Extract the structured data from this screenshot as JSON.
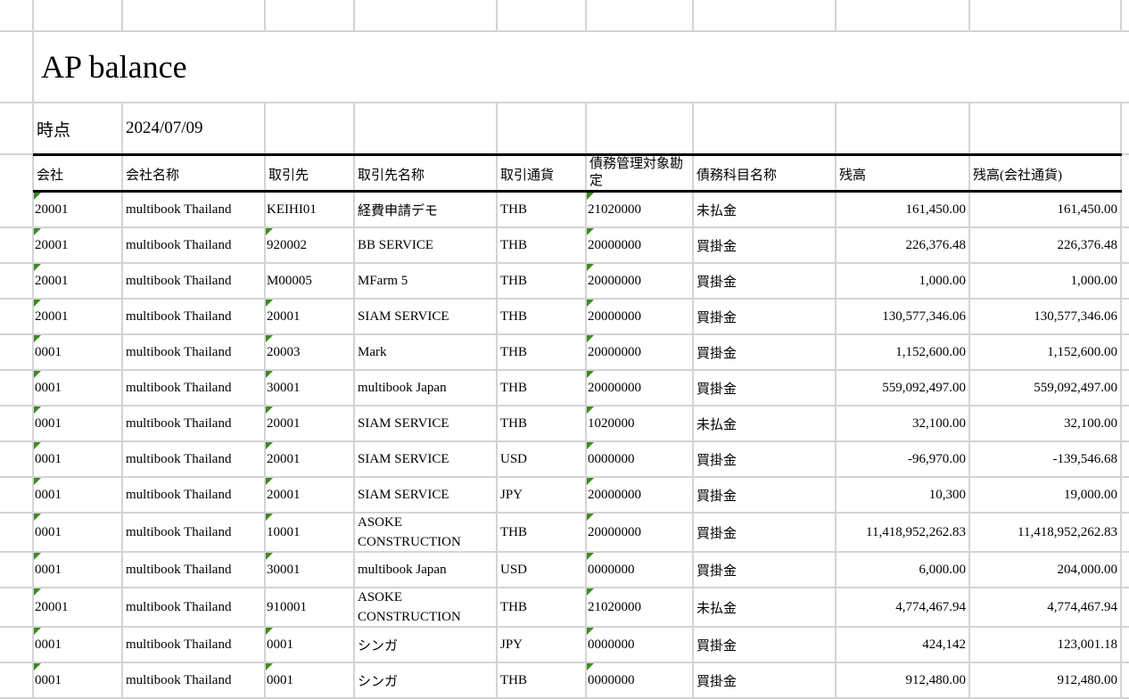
{
  "title": "AP balance",
  "as_of": {
    "label": "時点",
    "value": "2024/07/09"
  },
  "columns": [
    "会社",
    "会社名称",
    "取引先",
    "取引先名称",
    "取引通貨",
    "債務管理対象勘定",
    "債務科目名称",
    "残高",
    "残高(会社通貨)"
  ],
  "rows": [
    {
      "company": "20001",
      "company_name": "multibook Thailand",
      "partner": "KEIHI01",
      "partner_name": "経費申請デモ",
      "currency": "THB",
      "account": "21020000",
      "account_name": "未払金",
      "balance": "161,450.00",
      "balance_local": "161,450.00",
      "flag_company": true,
      "flag_partner": false,
      "flag_account": true
    },
    {
      "company": "20001",
      "company_name": "multibook Thailand",
      "partner": "920002",
      "partner_name": "BB SERVICE",
      "currency": "THB",
      "account": "20000000",
      "account_name": "買掛金",
      "balance": "226,376.48",
      "balance_local": "226,376.48",
      "flag_company": true,
      "flag_partner": true,
      "flag_account": true
    },
    {
      "company": "20001",
      "company_name": "multibook Thailand",
      "partner": "M00005",
      "partner_name": "MFarm 5",
      "currency": "THB",
      "account": "20000000",
      "account_name": "買掛金",
      "balance": "1,000.00",
      "balance_local": "1,000.00",
      "flag_company": true,
      "flag_partner": false,
      "flag_account": true
    },
    {
      "company": "20001",
      "company_name": "multibook Thailand",
      "partner": "20001",
      "partner_name": "SIAM SERVICE",
      "currency": "THB",
      "account": "20000000",
      "account_name": "買掛金",
      "balance": "130,577,346.06",
      "balance_local": "130,577,346.06",
      "flag_company": true,
      "flag_partner": true,
      "flag_account": true
    },
    {
      "company": "0001",
      "company_name": "multibook Thailand",
      "partner": "20003",
      "partner_name": "Mark",
      "currency": "THB",
      "account": "20000000",
      "account_name": "買掛金",
      "balance": "1,152,600.00",
      "balance_local": "1,152,600.00",
      "flag_company": true,
      "flag_partner": true,
      "flag_account": true
    },
    {
      "company": "0001",
      "company_name": "multibook Thailand",
      "partner": "30001",
      "partner_name": "multibook Japan",
      "currency": "THB",
      "account": "20000000",
      "account_name": "買掛金",
      "balance": "559,092,497.00",
      "balance_local": "559,092,497.00",
      "flag_company": true,
      "flag_partner": true,
      "flag_account": true
    },
    {
      "company": "0001",
      "company_name": "multibook Thailand",
      "partner": "20001",
      "partner_name": "SIAM SERVICE",
      "currency": "THB",
      "account": "1020000",
      "account_name": "未払金",
      "balance": "32,100.00",
      "balance_local": "32,100.00",
      "flag_company": true,
      "flag_partner": true,
      "flag_account": true
    },
    {
      "company": "0001",
      "company_name": "multibook Thailand",
      "partner": "20001",
      "partner_name": "SIAM SERVICE",
      "currency": "USD",
      "account": "0000000",
      "account_name": "買掛金",
      "balance": "-96,970.00",
      "balance_local": "-139,546.68",
      "flag_company": true,
      "flag_partner": true,
      "flag_account": true
    },
    {
      "company": "0001",
      "company_name": "multibook Thailand",
      "partner": "20001",
      "partner_name": "SIAM SERVICE",
      "currency": "JPY",
      "account": "20000000",
      "account_name": "買掛金",
      "balance": "10,300",
      "balance_local": "19,000.00",
      "flag_company": true,
      "flag_partner": true,
      "flag_account": true
    },
    {
      "company": "0001",
      "company_name": "multibook Thailand",
      "partner": "10001",
      "partner_name": "ASOKE CONSTRUCTION",
      "currency": "THB",
      "account": "20000000",
      "account_name": "買掛金",
      "balance": "11,418,952,262.83",
      "balance_local": "11,418,952,262.83",
      "flag_company": true,
      "flag_partner": true,
      "flag_account": true,
      "tall": true
    },
    {
      "company": "0001",
      "company_name": "multibook Thailand",
      "partner": "30001",
      "partner_name": "multibook Japan",
      "currency": "USD",
      "account": "0000000",
      "account_name": "買掛金",
      "balance": "6,000.00",
      "balance_local": "204,000.00",
      "flag_company": true,
      "flag_partner": true,
      "flag_account": true
    },
    {
      "company": "20001",
      "company_name": "multibook Thailand",
      "partner": "910001",
      "partner_name": "ASOKE CONSTRUCTION",
      "currency": "THB",
      "account": "21020000",
      "account_name": "未払金",
      "balance": "4,774,467.94",
      "balance_local": "4,774,467.94",
      "flag_company": true,
      "flag_partner": false,
      "flag_account": true,
      "tall": true
    },
    {
      "company": "0001",
      "company_name": "multibook Thailand",
      "partner": "0001",
      "partner_name": "シンガ",
      "currency": "JPY",
      "account": "0000000",
      "account_name": "買掛金",
      "balance": "424,142",
      "balance_local": "123,001.18",
      "flag_company": true,
      "flag_partner": true,
      "flag_account": true
    },
    {
      "company": "0001",
      "company_name": "multibook Thailand",
      "partner": "0001",
      "partner_name": "シンガ",
      "currency": "THB",
      "account": "0000000",
      "account_name": "買掛金",
      "balance": "912,480.00",
      "balance_local": "912,480.00",
      "flag_company": true,
      "flag_partner": true,
      "flag_account": true
    }
  ],
  "colors": {
    "grid": "#d4d4d4",
    "flag": "#3d8b1f",
    "rule": "#000000"
  },
  "icons": {
    "flag": "error-triangle-icon"
  }
}
